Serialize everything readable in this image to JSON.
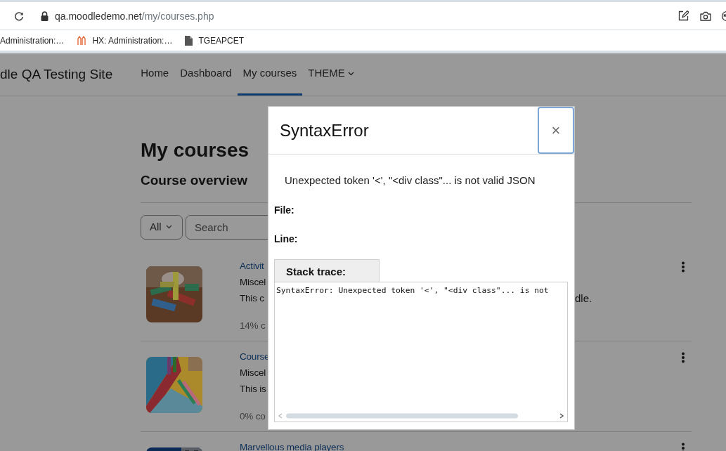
{
  "browser": {
    "url_host": "qa.moodledemo.net",
    "url_path": "/my/courses.php",
    "bookmarks": [
      {
        "label": "Administration:…"
      },
      {
        "label": "HX: Administration:…"
      },
      {
        "label": "TGEAPCET"
      }
    ]
  },
  "navbar": {
    "site_name": "dle QA Testing Site",
    "items": [
      {
        "label": "Home",
        "selected": false,
        "dropdown": false
      },
      {
        "label": "Dashboard",
        "selected": false,
        "dropdown": false
      },
      {
        "label": "My courses",
        "selected": true,
        "dropdown": false
      },
      {
        "label": "THEME",
        "selected": false,
        "dropdown": true
      }
    ]
  },
  "page": {
    "title": "My courses",
    "section": "Course overview",
    "filter": {
      "value": "All"
    },
    "search": {
      "placeholder": "Search"
    }
  },
  "courses": [
    {
      "name": "Activit",
      "category": "Miscel",
      "summary": "This c",
      "summary_tail": "dle.",
      "progress": "14% c"
    },
    {
      "name": "Course",
      "category": "Miscel",
      "summary": "This is",
      "progress": "0% co"
    },
    {
      "name": "Marvellous media players"
    }
  ],
  "modal": {
    "title": "SyntaxError",
    "close_label": "×",
    "message": "Unexpected token '<', \"<div class\"... is not valid JSON",
    "fields": [
      {
        "label": "File:"
      },
      {
        "label": "Line:"
      }
    ],
    "stack_label": "Stack trace:",
    "stack_text": "SyntaxError: Unexpected token '<', \"<div class\"... is not"
  }
}
